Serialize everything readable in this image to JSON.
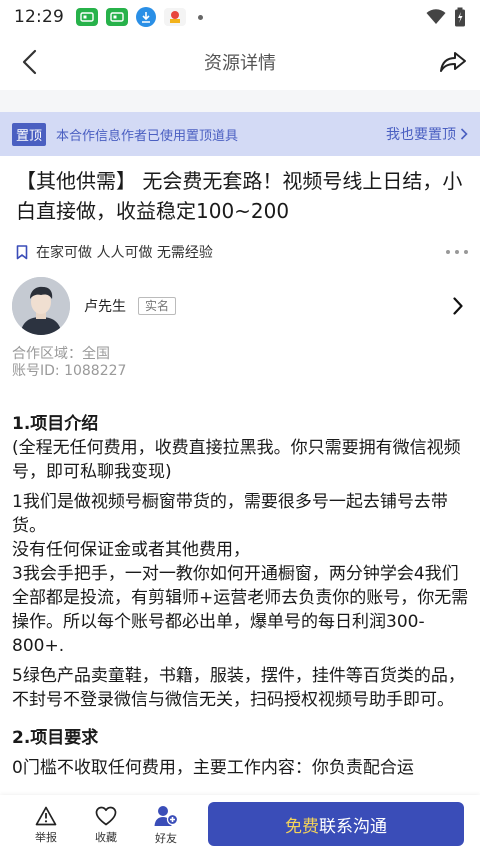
{
  "status_bar": {
    "time": "12:29"
  },
  "nav": {
    "title": "资源详情",
    "back_icon": "chevron-left-icon",
    "share_icon": "share-icon"
  },
  "pin_banner": {
    "tag": "置顶",
    "text": "本合作信息作者已使用置顶道具",
    "action": "我也要置顶"
  },
  "post": {
    "title": "【其他供需】 无会费无套路！视频号线上日结，小白直接做，收益稳定100~200",
    "tags": "在家可做 人人可做 无需经验"
  },
  "author": {
    "name": "卢先生",
    "badge": "实名"
  },
  "meta": {
    "area": "合作区域：全国",
    "account": "账号ID: 1088227"
  },
  "content": {
    "h1": "1.项目介绍",
    "p1": "(全程无任何费用，收费直接拉黑我。你只需要拥有微信视频号，即可私聊我变现)",
    "p2": "1我们是做视频号橱窗带货的，需要很多号一起去铺号去带货。",
    "p3": "没有任何保证金或者其他费用，",
    "p4": "3我会手把手，一对一教你如何开通橱窗，两分钟学会4我们全部都是投流，有剪辑师+运营老师去负责你的账号，你无需操作。所以每个账号都必出单，爆单号的每日利润300-800+.",
    "p5": "5绿色产品卖童鞋，书籍，服装，摆件，挂件等百货类的品，不封号不登录微信与微信无关，扫码授权视频号助手即可。",
    "h2": "2.项目要求",
    "p6": "0门槛不收取任何费用，主要工作内容：你负责配合运"
  },
  "bottom_bar": {
    "report": "举报",
    "favorite": "收藏",
    "friend": "好友",
    "cta_free": "免费",
    "cta_main": "联系沟通"
  },
  "colors": {
    "accent": "#3a4db8",
    "banner_bg": "#d3daf5",
    "cta_highlight": "#f3d35a"
  }
}
